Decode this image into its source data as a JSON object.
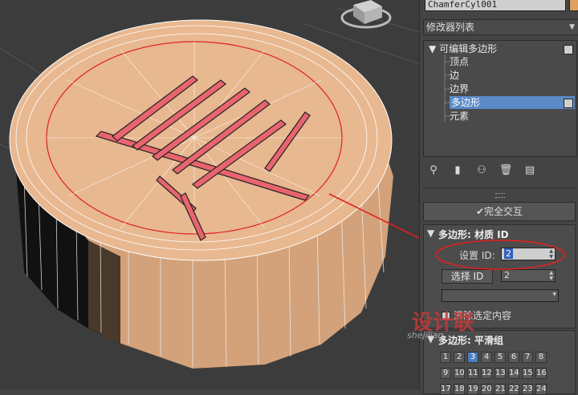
{
  "panel": {
    "object_name": "ChamferCyl001",
    "object_color": "#e0a060",
    "modifier_list_label": "修改器列表",
    "stack": {
      "root": "可编辑多边形",
      "items": [
        "顶点",
        "边",
        "边界",
        "多边形",
        "元素"
      ],
      "selected": "多边形"
    },
    "toolbar_icons": [
      "pin-icon",
      "show-end-result-icon",
      "make-unique-icon",
      "remove-modifier-icon",
      "configure-modifier-sets-icon"
    ],
    "full_interactive_label": "完全交互",
    "material_rollout": {
      "title": "多边形: 材质 ID",
      "set_id_label": "设置 ID:",
      "set_id_value": "2",
      "select_id_label": "选择 ID",
      "select_id_value": "2",
      "clear_selection_label": "清除选定内容"
    },
    "smoothing_rollout": {
      "title": "多边形: 平滑组",
      "groups": [
        "1",
        "2",
        "3",
        "4",
        "5",
        "6",
        "7",
        "8",
        "9",
        "10",
        "11",
        "12",
        "13",
        "14",
        "15",
        "16",
        "17",
        "18",
        "19",
        "20",
        "21",
        "22",
        "23",
        "24"
      ],
      "active_group": "3"
    }
  },
  "watermark": {
    "logo_text": "设计联",
    "url_text": "shejilian"
  },
  "colors": {
    "accent": "#5a8ac8",
    "annotation": "#e02020",
    "model": "#e8b890"
  }
}
